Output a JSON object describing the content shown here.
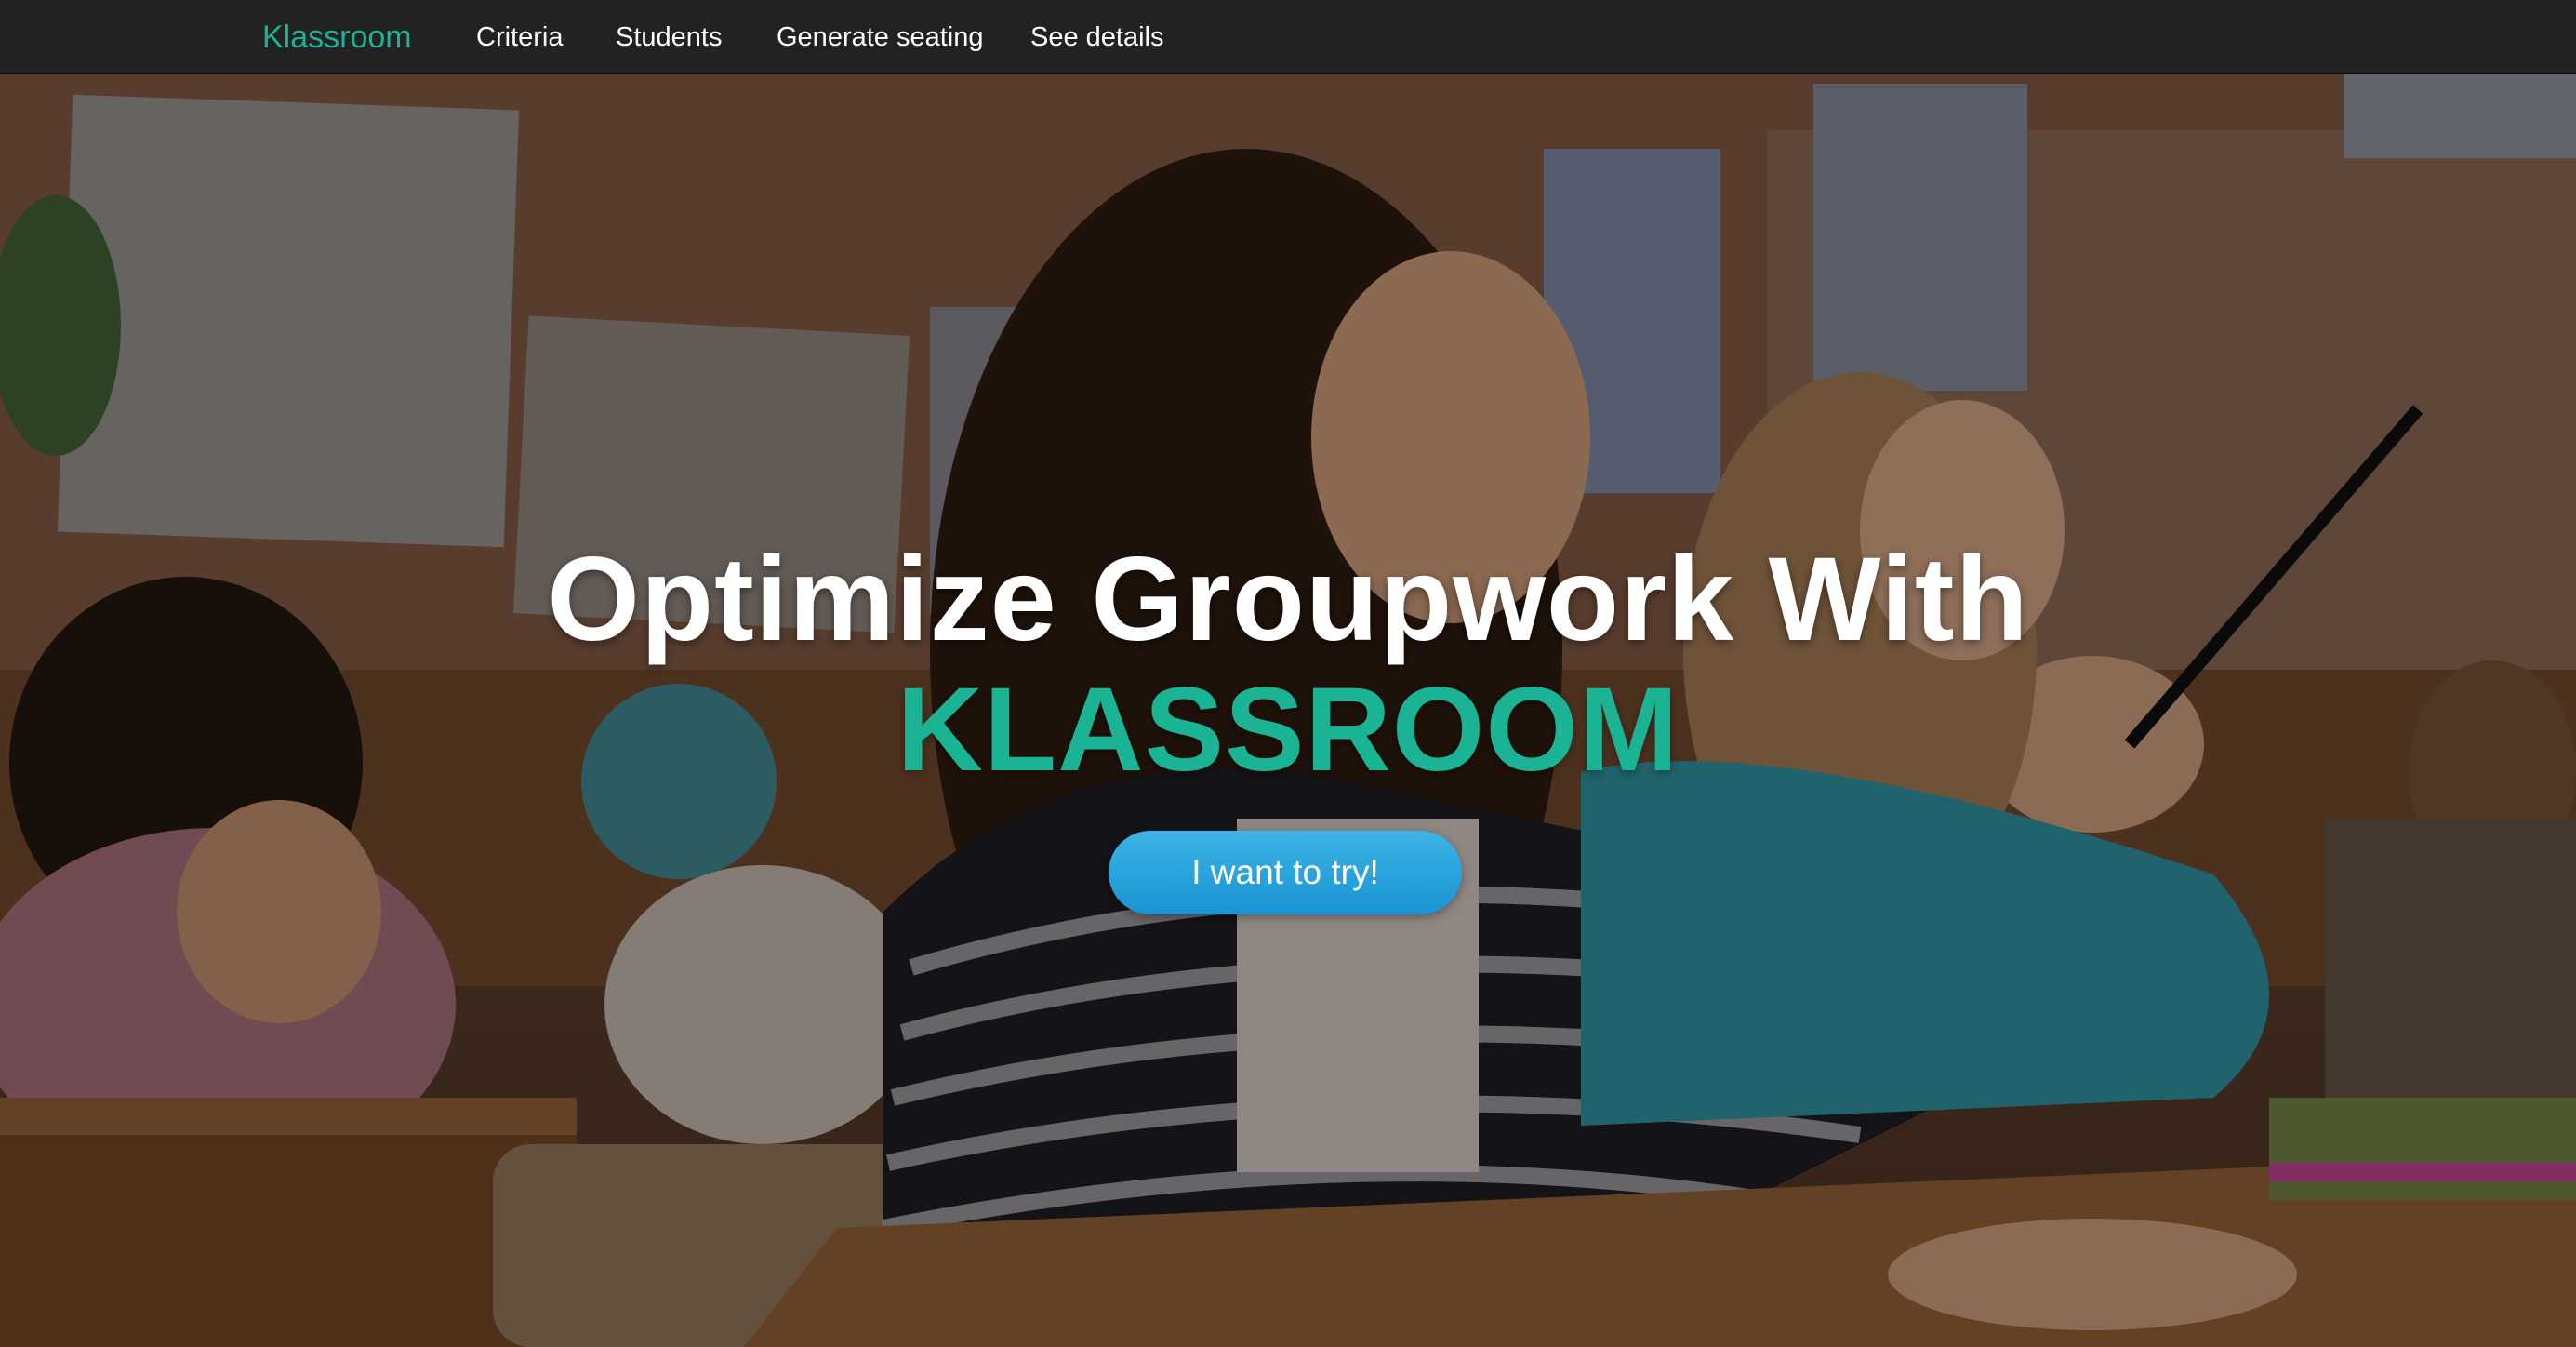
{
  "navbar": {
    "brand": "Klassroom",
    "items": [
      "Criteria",
      "Students",
      "Generate seating",
      "See details"
    ]
  },
  "hero": {
    "title": "Optimize Groupwork With",
    "brand": "KLASSROOM",
    "cta_label": "I want to try!",
    "background_image": "classroom-students-photo"
  },
  "colors": {
    "navbar_bg": "#222222",
    "accent_teal": "#1ab394",
    "cta_blue": "#1a93d2"
  }
}
